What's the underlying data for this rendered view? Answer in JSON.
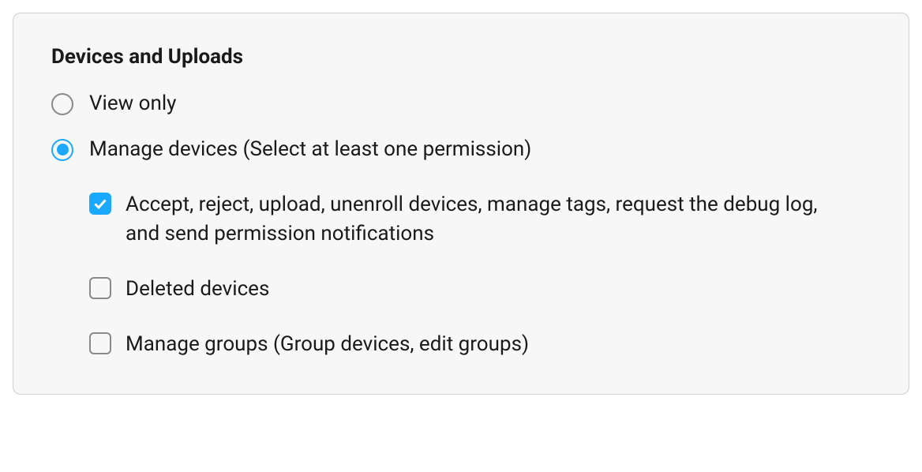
{
  "section": {
    "title": "Devices and Uploads",
    "radios": {
      "viewOnly": {
        "label": "View only",
        "selected": false
      },
      "manageDevices": {
        "label": "Manage devices (Select at least one permission)",
        "selected": true
      }
    },
    "checkboxes": {
      "acceptReject": {
        "label": "Accept, reject, upload, unenroll devices, manage tags, request the debug log, and send permission notifications",
        "checked": true
      },
      "deletedDevices": {
        "label": "Deleted devices",
        "checked": false
      },
      "manageGroups": {
        "label": "Manage groups (Group devices, edit groups)",
        "checked": false
      }
    }
  }
}
